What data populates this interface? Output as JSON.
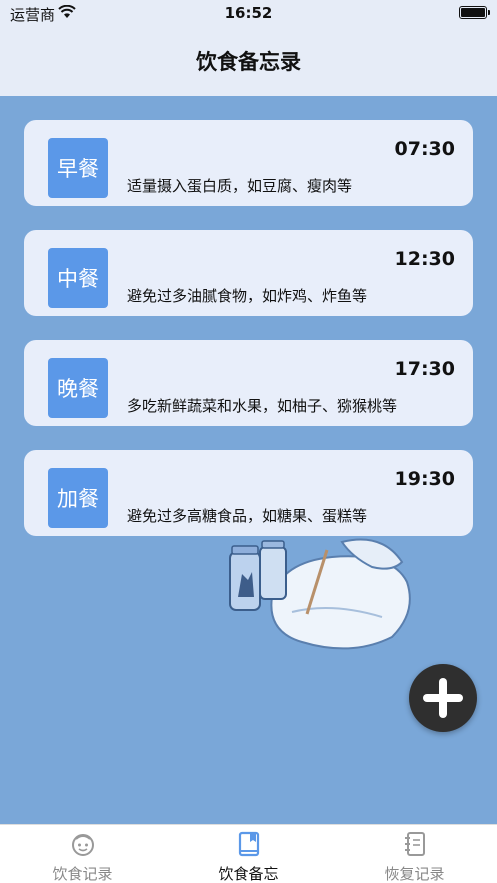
{
  "status_bar": {
    "carrier": "运营商",
    "time": "16:52"
  },
  "nav": {
    "title": "饮食备忘录"
  },
  "meals": [
    {
      "label": "早餐",
      "time": "07:30",
      "note": "适量摄入蛋白质，如豆腐、瘦肉等"
    },
    {
      "label": "中餐",
      "time": "12:30",
      "note": "避免过多油腻食物，如炸鸡、炸鱼等"
    },
    {
      "label": "晚餐",
      "time": "17:30",
      "note": "多吃新鲜蔬菜和水果，如柚子、猕猴桃等"
    },
    {
      "label": "加餐",
      "time": "19:30",
      "note": "避免过多高糖食品，如糖果、蛋糕等"
    }
  ],
  "tabs": [
    {
      "label": "饮食记录",
      "icon": "face-icon"
    },
    {
      "label": "饮食备忘",
      "icon": "book-icon",
      "active": true
    },
    {
      "label": "恢复记录",
      "icon": "notebook-icon"
    }
  ],
  "colors": {
    "background": "#7aa7d8",
    "card": "#e8eefa",
    "badge": "#5b98e8",
    "tab_active": "#5b98e8",
    "fab": "#2f2f2f"
  }
}
